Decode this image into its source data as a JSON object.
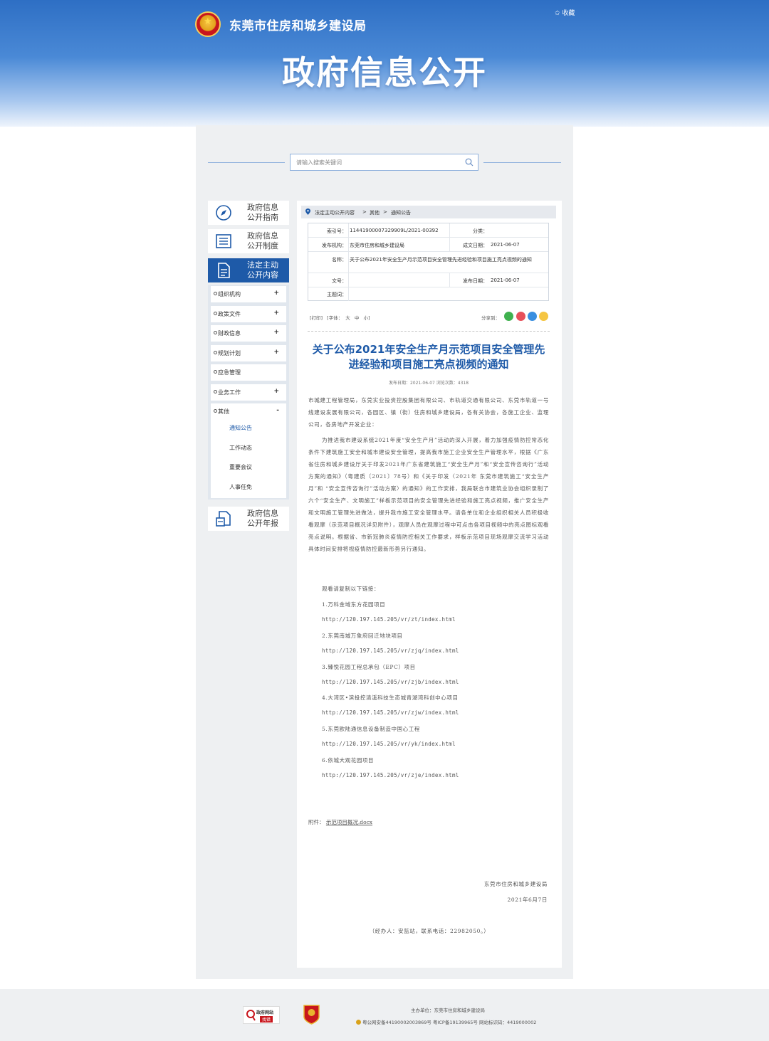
{
  "header": {
    "site_name": "东莞市住房和城乡建设局",
    "favorite": "✩ 收藏",
    "hero_title": "政府信息公开"
  },
  "search": {
    "placeholder": "请输入搜索关键词"
  },
  "sidebar": {
    "cards": [
      {
        "line1": "政府信息",
        "line2": "公开指南",
        "icon": "compass-icon"
      },
      {
        "line1": "政府信息",
        "line2": "公开制度",
        "icon": "list-document-icon"
      },
      {
        "line1": "法定主动",
        "line2": "公开内容",
        "icon": "document-icon"
      },
      {
        "line1": "政府信息",
        "line2": "公开年报",
        "icon": "report-icon"
      }
    ],
    "sub_items": [
      {
        "label": "组织机构",
        "expand": "+"
      },
      {
        "label": "政策文件",
        "expand": "+"
      },
      {
        "label": "财政信息",
        "expand": "+"
      },
      {
        "label": "规划计划",
        "expand": "+"
      },
      {
        "label": "应急管理",
        "expand": ""
      },
      {
        "label": "业务工作",
        "expand": "+"
      },
      {
        "label": "其他",
        "expand": "-"
      }
    ],
    "children": [
      "通知公告",
      "工作动态",
      "重要会议",
      "人事任免"
    ]
  },
  "breadcrumb": [
    "法定主动公开内容",
    "其他",
    "通知公告"
  ],
  "breadcrumb_sep": ">",
  "meta": {
    "index_label": "索引号：",
    "index_value": "11441900007329909L/2021-00392",
    "category_label": "分类：",
    "category_value": "",
    "publisher_label": "发布机构：",
    "publisher_value": "东莞市住房和城乡建设局",
    "written_date_label": "成文日期：",
    "written_date_value": "2021-06-07",
    "name_label": "名称：",
    "name_value": "关于公布2021年安全生产月示范项目安全管理先进经验和项目施工亮点视频的通知",
    "doc_no_label": "文号：",
    "doc_no_value": "",
    "publish_date_label": "发布日期：",
    "publish_date_value": "2021-06-07",
    "subject_label": "主题词："
  },
  "tools": {
    "print": "[打印]",
    "font": "[字体：",
    "big": "大",
    "mid": "中",
    "small": "小]",
    "share": "分享到："
  },
  "article": {
    "title": "关于公布2021年安全生产月示范项目安全管理先进经验和项目施工亮点视频的通知",
    "meta": "发布日期：2021-06-07  浏览次数：4318",
    "recipients": "市城建工程管理局，东莞实业投资控股集团有限公司、市轨道交通有限公司、东莞市轨道一号线建设发展有限公司，各园区、镇（街）住房和城乡建设局，各有关协会，各施工企业、监理公司，各房地产开发企业：",
    "paragraph": "为推进我市建设系统2021年度“安全生产月”活动的深入开展，着力加强疫情防控常态化条件下建筑施工安全和城市建设安全管理，提高我市施工企业安全生产管理水平，根据《广东省住房和城乡建设厅关于印发2021年广东省建筑施工“安全生产月”和“安全宣传咨询行”活动方案的通知》（粤建质〔2021〕78号）和《关于印发〈2021年 东莞市建筑施工“安全生产月”和 “安全宣传咨询行”活动方案〉的通知》的工作安排，我局联合市建筑业协会组织录制了六个“安全生产、文明施工”样板示范项目的安全管理先进经验和施工亮点视频，推广安全生产和文明施工管理先进做法，提升我市施工安全管理水平。请各单位和企业组织相关人员积极收看观摩（示范项目概况详见附件），观摩人员在观摩过程中可点击各项目视频中的亮点图标观看亮点说明。根据省、市新冠肺炎疫情防控相关工作要求，样板示范项目现场观摩交流学习活动具体时间安排将视疫情防控最新形势另行通知。",
    "watch_intro": "观看请复制以下链接：",
    "links": [
      {
        "name": "1.万科金域东方花园项目",
        "url": "http://120.197.145.205/vr/zt/index.html"
      },
      {
        "name": "2.东莞南城万象府回迁地块项目",
        "url": "http://120.197.145.205/vr/zjq/index.html"
      },
      {
        "name": "3.臻悦花园工程总承包（EPC）项目",
        "url": "http://120.197.145.205/vr/zjb/index.html"
      },
      {
        "name": "4.大湾区•滨投控清溪科技生态城青湖湾科创中心项目",
        "url": "http://120.197.145.205/vr/zjw/index.html"
      },
      {
        "name": "5.东莞欧陆通信息设备制造中国心工程",
        "url": "http://120.197.145.205/vr/yk/index.html"
      },
      {
        "name": "6.依城大观花园项目",
        "url": "http://120.197.145.205/vr/zje/index.html"
      }
    ],
    "attachment_label": "附件：",
    "attachment_name": "示范项目概况.docx",
    "signature": "东莞市住房和城乡建设局",
    "date": "2021年6月7日",
    "contact": "（经办人：安监站，联系电话：22982050。）"
  },
  "footer": {
    "badge_text1": "政府网站",
    "badge_text2": "找错",
    "sponsor": "主办单位：东莞市住房和城乡建设局",
    "record": "粤公网安备44190002003869号 粤ICP备19139965号 网站标识码：4419000002"
  },
  "colors": {
    "primary": "#1e5aa8",
    "banner": "#2e6fc4",
    "panel_bg": "#eef0f2"
  }
}
